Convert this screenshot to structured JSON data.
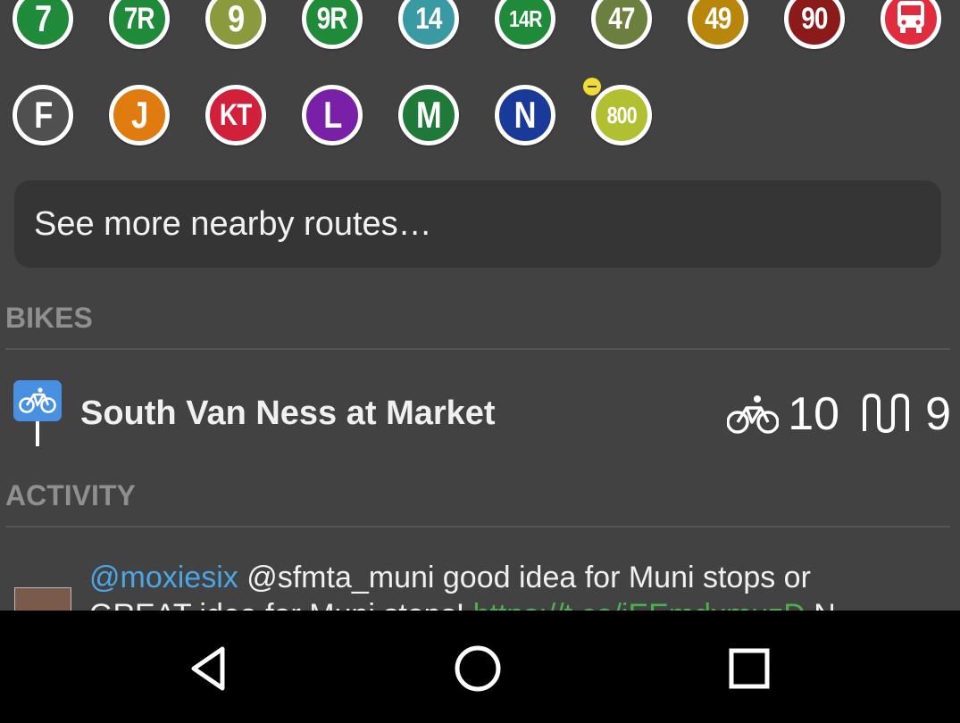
{
  "routes_row1": [
    {
      "label": "7",
      "color": "#1f8a3a"
    },
    {
      "label": "7R",
      "color": "#1f8a3a"
    },
    {
      "label": "9",
      "color": "#8a9a3c"
    },
    {
      "label": "9R",
      "color": "#1f8a3a"
    },
    {
      "label": "14",
      "color": "#3a9aa3"
    },
    {
      "label": "14R",
      "color": "#1f8a3a"
    },
    {
      "label": "47",
      "color": "#6b7f3f"
    },
    {
      "label": "49",
      "color": "#b8860b"
    },
    {
      "label": "90",
      "color": "#8b1a1a"
    },
    {
      "label": "",
      "color": "#e02c3c",
      "icon": "bus-icon"
    }
  ],
  "routes_row2": [
    {
      "label": "F",
      "color": "#505050"
    },
    {
      "label": "J",
      "color": "#e07b10"
    },
    {
      "label": "KT",
      "color": "#d0203a"
    },
    {
      "label": "L",
      "color": "#7a20a8"
    },
    {
      "label": "M",
      "color": "#1f7a3a"
    },
    {
      "label": "N",
      "color": "#1a3a9a"
    },
    {
      "label": "800",
      "color": "#b0c030",
      "favorite": true
    }
  ],
  "more_routes": {
    "label": "See more nearby routes…"
  },
  "bikes": {
    "header": "BIKES",
    "station": "South Van Ness at Market",
    "bikes_available": "10",
    "docks_available": "9",
    "icons": {
      "sign": "bike-station-sign-icon",
      "bikes": "bicycle-icon",
      "docks": "dock-icon"
    },
    "sign_color": "#4a90e2"
  },
  "activity": {
    "header": "ACTIVITY",
    "mention": "@moxiesix",
    "text": " @sfmta_muni good idea for Muni stops or ",
    "line2_text": "GREAT idea for Muni stops! ",
    "line2_link": "https://t.co/iEEmdxmuzD",
    "line2_tail": " N..."
  },
  "navbar": {
    "icons": [
      "back-icon",
      "home-icon",
      "recents-icon"
    ]
  }
}
